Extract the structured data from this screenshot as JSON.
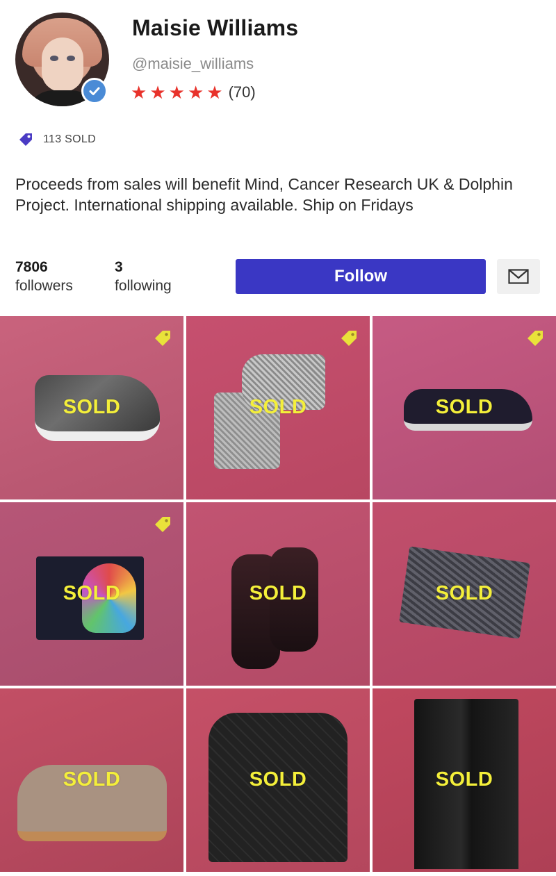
{
  "profile": {
    "name": "Maisie Williams",
    "handle": "@maisie_williams",
    "rating_count": "(70)",
    "stars": 5,
    "sold_count": "113 SOLD",
    "bio": "Proceeds from sales will benefit Mind, Cancer Research UK & Dolphin Project. International shipping available. Ship on Fridays",
    "followers_count": "7806",
    "followers_label": "followers",
    "following_count": "3",
    "following_label": "following",
    "follow_label": "Follow"
  },
  "colors": {
    "accent": "#3a37c4",
    "star": "#e8322b",
    "sold_text": "#f4ef3a",
    "verified": "#4a8bd6",
    "tag": "#4a3bc4"
  },
  "icons": {
    "verified": "verified-check-icon",
    "sold_tag": "price-tag-icon",
    "message": "envelope-icon",
    "star": "star-icon"
  },
  "listings": [
    {
      "item": "camo high-top sneaker",
      "label": "SOLD",
      "price_tag": true
    },
    {
      "item": "glitter ankle boots",
      "label": "SOLD",
      "price_tag": true
    },
    {
      "item": "navy suede trainer",
      "label": "SOLD",
      "price_tag": true
    },
    {
      "item": "printed zip pouch",
      "label": "SOLD",
      "price_tag": true
    },
    {
      "item": "patent loafers",
      "label": "SOLD",
      "price_tag": false
    },
    {
      "item": "metallic clutch",
      "label": "SOLD",
      "price_tag": false
    },
    {
      "item": "suede desert boot",
      "label": "SOLD",
      "price_tag": false
    },
    {
      "item": "quilted jacket",
      "label": "SOLD",
      "price_tag": false
    },
    {
      "item": "wide-leg trousers",
      "label": "SOLD",
      "price_tag": false
    }
  ]
}
